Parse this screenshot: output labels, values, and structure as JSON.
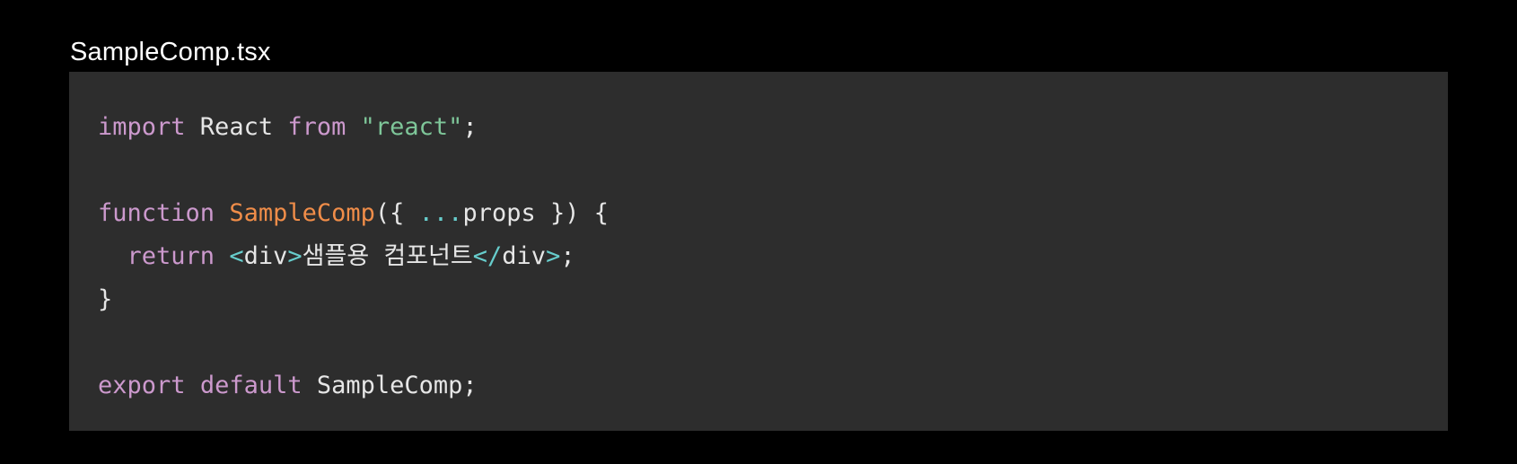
{
  "file": {
    "name": "SampleComp.tsx"
  },
  "colors": {
    "background": "#000000",
    "code_background": "#2d2d2d",
    "keyword": "#cc99cd",
    "plain": "#e6e6e6",
    "string": "#7ec699",
    "function_name": "#f08d49",
    "punctuation": "#67cdcc"
  },
  "code": {
    "lines": [
      [
        {
          "text": "import",
          "kind": "keyword"
        },
        {
          "text": " React ",
          "kind": "plain"
        },
        {
          "text": "from",
          "kind": "keyword"
        },
        {
          "text": " ",
          "kind": "plain"
        },
        {
          "text": "\"react\"",
          "kind": "string"
        },
        {
          "text": ";",
          "kind": "plain"
        }
      ],
      [],
      [
        {
          "text": "function",
          "kind": "keyword"
        },
        {
          "text": " ",
          "kind": "plain"
        },
        {
          "text": "SampleComp",
          "kind": "function_name"
        },
        {
          "text": "({ ",
          "kind": "plain"
        },
        {
          "text": "...",
          "kind": "punctuation"
        },
        {
          "text": "props }) {",
          "kind": "plain"
        }
      ],
      [
        {
          "text": "  ",
          "kind": "plain"
        },
        {
          "text": "return",
          "kind": "keyword"
        },
        {
          "text": " ",
          "kind": "plain"
        },
        {
          "text": "<",
          "kind": "punctuation"
        },
        {
          "text": "div",
          "kind": "plain"
        },
        {
          "text": ">",
          "kind": "punctuation"
        },
        {
          "text": "샘플용 컴포넌트",
          "kind": "plain"
        },
        {
          "text": "</",
          "kind": "punctuation"
        },
        {
          "text": "div",
          "kind": "plain"
        },
        {
          "text": ">",
          "kind": "punctuation"
        },
        {
          "text": ";",
          "kind": "plain"
        }
      ],
      [
        {
          "text": "}",
          "kind": "plain"
        }
      ],
      [],
      [
        {
          "text": "export",
          "kind": "keyword"
        },
        {
          "text": " ",
          "kind": "plain"
        },
        {
          "text": "default",
          "kind": "keyword"
        },
        {
          "text": " SampleComp;",
          "kind": "plain"
        }
      ]
    ]
  }
}
